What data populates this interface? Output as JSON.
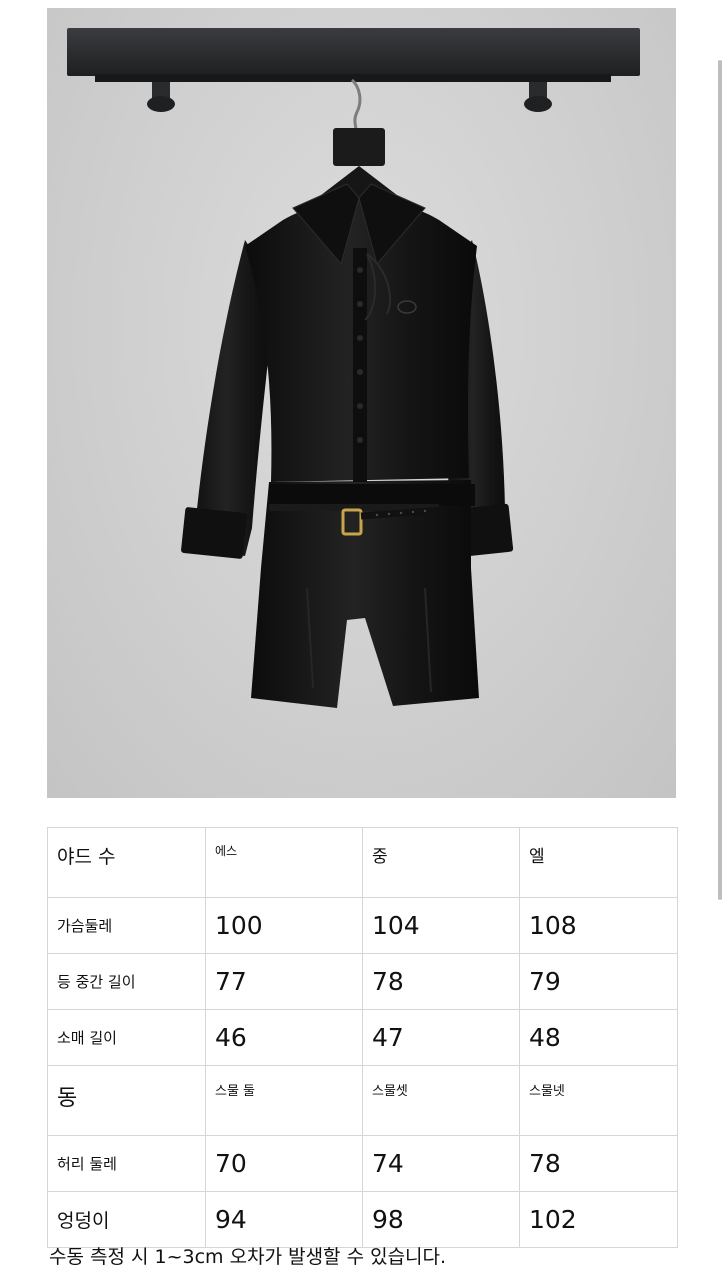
{
  "product_photo": {
    "alt": "Black long-sleeve shirt romper with belt on hanger",
    "colors": {
      "wall": "#cfcfcf",
      "rail": "#2b2d2f",
      "garment": "#141414",
      "buckle": "#c9a64a"
    }
  },
  "size_table": {
    "rows": [
      {
        "label": "야드 수",
        "values": [
          "에스",
          "중",
          "엘"
        ]
      },
      {
        "label": "가슴둘레",
        "values": [
          "100",
          "104",
          "108"
        ]
      },
      {
        "label": "등 중간 길이",
        "values": [
          "77",
          "78",
          "79"
        ]
      },
      {
        "label": "소매 길이",
        "values": [
          "46",
          "47",
          "48"
        ]
      },
      {
        "label": "동",
        "values": [
          "스물 둘",
          "스물셋",
          "스물넷"
        ]
      },
      {
        "label": "허리 둘레",
        "values": [
          "70",
          "74",
          "78"
        ]
      },
      {
        "label": "엉덩이",
        "values": [
          "94",
          "98",
          "102"
        ]
      }
    ]
  },
  "footer_note": "수동 측정 시 1~3cm 오차가 발생할 수 있습니다."
}
